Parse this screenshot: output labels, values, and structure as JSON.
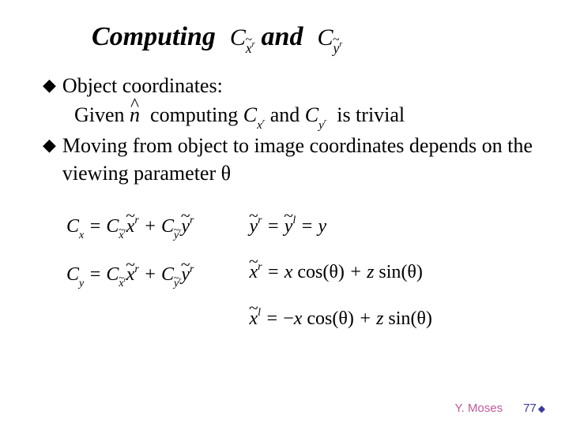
{
  "title": {
    "word1": "Computing",
    "sym1_base": "C",
    "sym1_subvar": "x",
    "sym1_supr": "r",
    "and": "and",
    "sym2_base": "C",
    "sym2_subvar": "y",
    "sym2_supr": "r"
  },
  "bullets": {
    "b1_label": "Object coordinates:",
    "given": "Given ",
    "nhat": "n",
    "computing": "  computing ",
    "cxr_C": "C",
    "cxr_sub": "x",
    "cxr_sup": "r",
    "and2": " and ",
    "cyr_C": "C",
    "cyr_sub": "y",
    "cyr_sup": "r",
    "trivial": "  is trivial",
    "b2_text": "Moving from object to image coordinates depends on the viewing parameter θ"
  },
  "eq": {
    "l1": {
      "C": "C",
      "x": "x",
      "eq": " = ",
      "Cxt_C": "C",
      "xt": "x",
      "xt_sub": "x",
      "xt_sup": "r",
      "plus": " + ",
      "Cyt_C": "C",
      "yt": "y",
      "yt_sub": "y",
      "yt_sup": "r"
    },
    "l2": {
      "C": "C",
      "y": "y",
      "eq": " = ",
      "Cxt_C": "C",
      "xt": "x",
      "xt_sub": "x",
      "xt_sup": "r",
      "plus": " + ",
      "Cyt_C": "C",
      "yt": "y",
      "yt_sub": "y",
      "yt_sup": "r"
    },
    "r1": {
      "yr": "y",
      "sup_r": "r",
      "eq": " = ",
      "yl": "y",
      "sup_l": "l",
      "eq2": " = ",
      "y": "y"
    },
    "r2": {
      "xr": "x",
      "sup_r": "r",
      "eq": " = ",
      "x": "x",
      "cos": " cos",
      "th": "(θ)",
      "plus": " + ",
      "z": "z",
      "sin": " sin",
      "th2": "(θ)"
    },
    "r3": {
      "xl": "x",
      "sup_l": "l",
      "eq": " = ",
      "minus": "−",
      "x": "x",
      "cos": " cos",
      "th": "(θ)",
      "plus": " + ",
      "z": "z",
      "sin": " sin",
      "th2": "(θ)"
    }
  },
  "footer": {
    "author": "Y. Moses",
    "page": "77"
  }
}
